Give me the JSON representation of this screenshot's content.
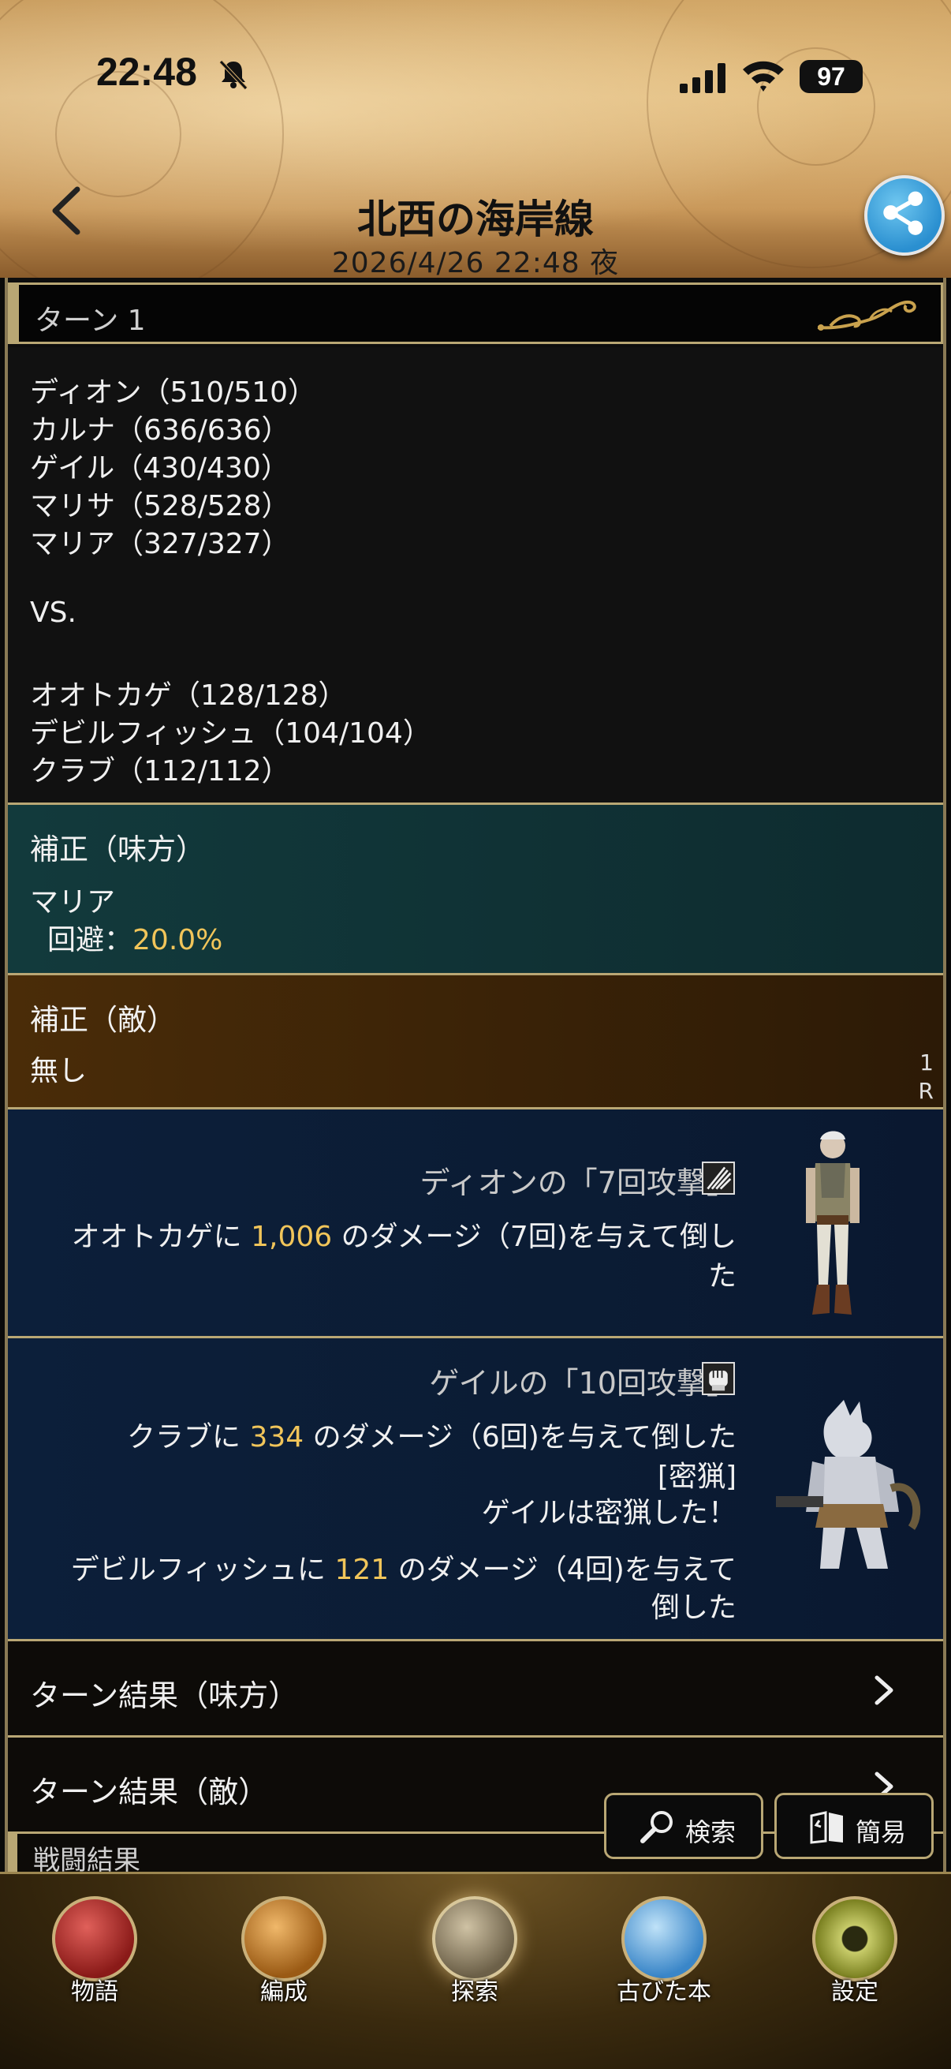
{
  "status": {
    "time": "22:48",
    "battery": "97"
  },
  "header": {
    "title": "北西の海岸線",
    "date": "2026/4/26 22:48 夜"
  },
  "turn": {
    "label": "ターン 1"
  },
  "roster": {
    "allies": [
      "ディオン（510/510）",
      "カルナ（636/636）",
      "ゲイル（430/430）",
      "マリサ（528/528）",
      "マリア（327/327）"
    ],
    "vs": "VS.",
    "enemies": [
      "オオトカゲ（128/128）",
      "デビルフィッシュ（104/104）",
      "クラブ（112/112）"
    ]
  },
  "buff_ally": {
    "title": "補正（味方）",
    "name": "マリア",
    "stat_label": "回避：",
    "stat_value": "20.0%"
  },
  "buff_enemy": {
    "title": "補正（敵）",
    "value": "無し",
    "round_1": "1",
    "round_2": "R"
  },
  "actions": [
    {
      "title": "ディオンの「7回攻撃」",
      "pre": "オオトカゲに",
      "damage": "1,006",
      "post": "のダメージ（7回)を与えて倒し",
      "post2": "た"
    },
    {
      "title": "ゲイルの「10回攻撃」",
      "line1_pre": "クラブに",
      "line1_damage": "334",
      "line1_post": "のダメージ（6回)を与えて倒した",
      "tag": "[密猟]",
      "note": "ゲイルは密猟した！",
      "line2_pre": "デビルフィッシュに",
      "line2_damage": "121",
      "line2_post": "のダメージ（4回)を与えて",
      "line2_post2": "倒した"
    }
  ],
  "results": {
    "ally": "ターン結果（味方）",
    "enemy": "ターン結果（敵）",
    "battle": "戦闘結果"
  },
  "float_buttons": {
    "search": "検索",
    "simple": "簡易"
  },
  "nav": [
    {
      "label": "物語",
      "color": "#b02a28"
    },
    {
      "label": "編成",
      "color": "#d08a2a"
    },
    {
      "label": "探索",
      "color": "#8a7a60"
    },
    {
      "label": "古びた本",
      "color": "#5aa0d8"
    },
    {
      "label": "設定",
      "color": "#9aa04a"
    }
  ]
}
